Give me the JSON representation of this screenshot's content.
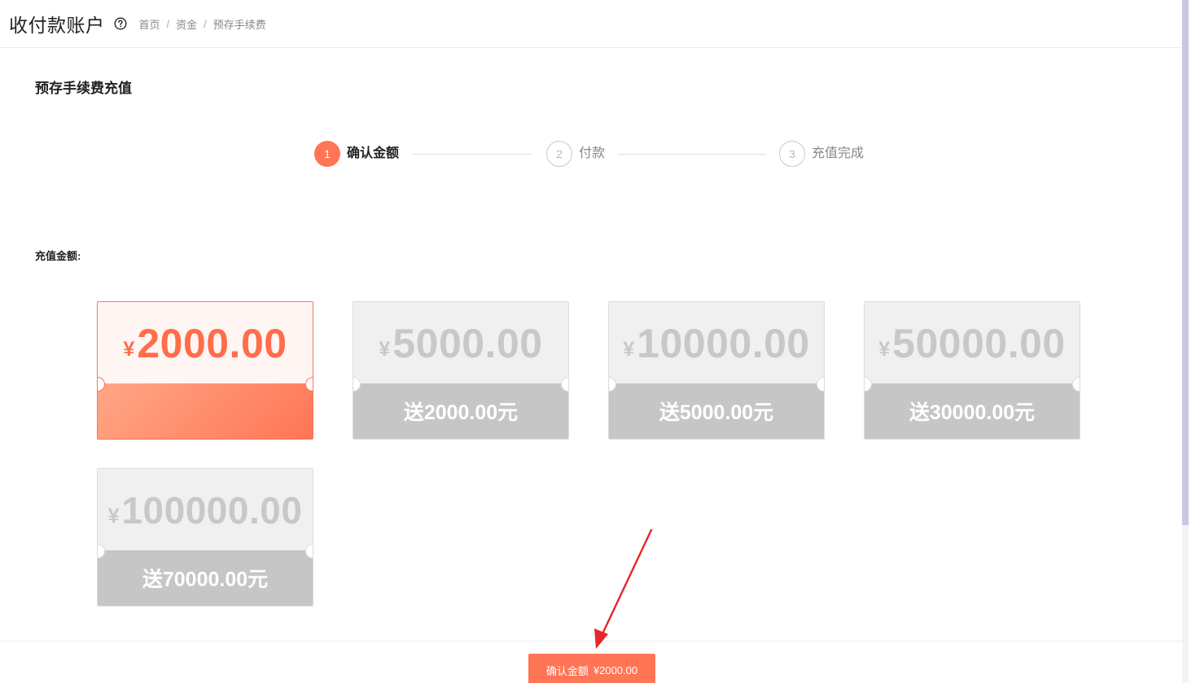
{
  "header": {
    "title": "收付款账户",
    "help_icon": "question-circle-icon",
    "breadcrumb": [
      "首页",
      "资金",
      "预存手续费"
    ]
  },
  "section": {
    "title": "预存手续费充值"
  },
  "steps": [
    {
      "number": "1",
      "label": "确认金额",
      "state": "active"
    },
    {
      "number": "2",
      "label": "付款",
      "state": "idle"
    },
    {
      "number": "3",
      "label": "充值完成",
      "state": "idle"
    }
  ],
  "amount_label": "充值金额:",
  "options": [
    {
      "currency": "¥",
      "amount": "2000.00",
      "bonus": "",
      "selected": true
    },
    {
      "currency": "¥",
      "amount": "5000.00",
      "bonus": "送2000.00元",
      "selected": false
    },
    {
      "currency": "¥",
      "amount": "10000.00",
      "bonus": "送5000.00元",
      "selected": false
    },
    {
      "currency": "¥",
      "amount": "50000.00",
      "bonus": "送30000.00元",
      "selected": false
    },
    {
      "currency": "¥",
      "amount": "100000.00",
      "bonus": "送70000.00元",
      "selected": false
    }
  ],
  "confirm": {
    "label": "确认金额",
    "amount": "¥2000.00"
  },
  "colors": {
    "accent": "#ff7555",
    "card_inactive_top": "#f0f0f0",
    "card_inactive_bottom": "#c6c6c6",
    "arrow": "#e8262a"
  }
}
